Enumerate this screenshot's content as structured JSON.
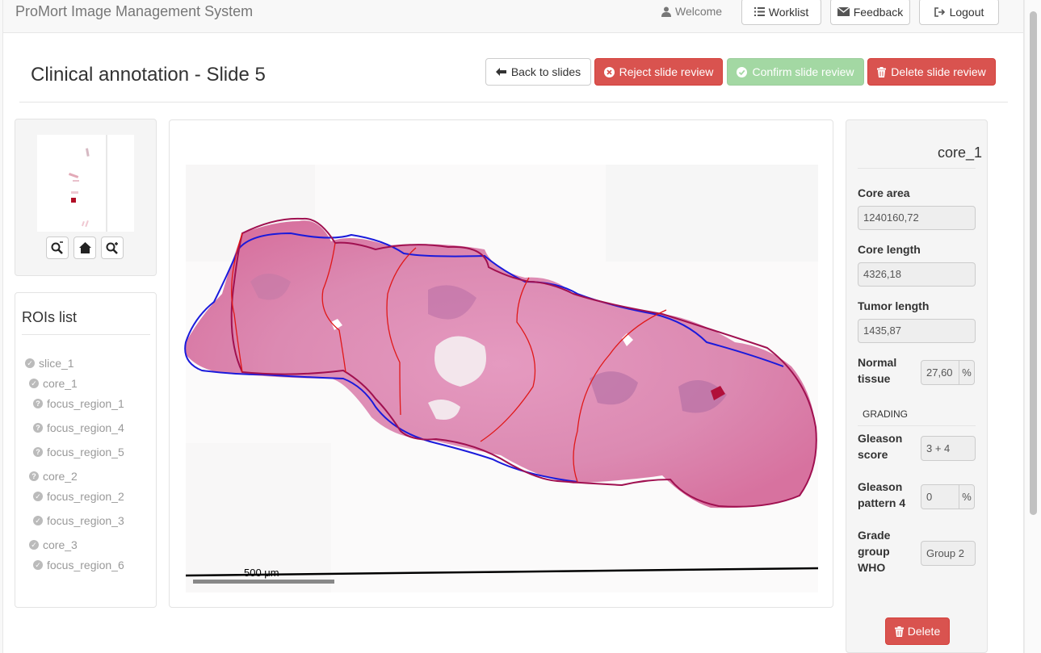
{
  "navbar": {
    "brand": "ProMort Image Management System",
    "welcome": "Welcome",
    "worklist": "Worklist",
    "feedback": "Feedback",
    "logout": "Logout"
  },
  "header": {
    "title": "Clinical annotation - Slide 5",
    "back_label": "Back to slides",
    "reject_label": "Reject slide review",
    "confirm_label": "Confirm slide review",
    "delete_label": "Delete slide review"
  },
  "rois": {
    "title": "ROIs list",
    "items": [
      {
        "label": "slice_1",
        "status": "done"
      },
      {
        "label": "core_1",
        "status": "done"
      },
      {
        "label": "focus_region_1",
        "status": "pending"
      },
      {
        "label": "focus_region_4",
        "status": "pending"
      },
      {
        "label": "focus_region_5",
        "status": "pending"
      },
      {
        "label": "core_2",
        "status": "pending"
      },
      {
        "label": "focus_region_2",
        "status": "done"
      },
      {
        "label": "focus_region_3",
        "status": "done"
      },
      {
        "label": "core_3",
        "status": "done"
      },
      {
        "label": "focus_region_6",
        "status": "done"
      }
    ]
  },
  "viewer": {
    "scale_label": "500 μm"
  },
  "details": {
    "title": "core_1",
    "core_area_label": "Core area",
    "core_area_value": "1240160,72",
    "core_length_label": "Core length",
    "core_length_value": "4326,18",
    "tumor_length_label": "Tumor length",
    "tumor_length_value": "1435,87",
    "normal_tissue_label_1": "Normal",
    "normal_tissue_label_2": "tissue",
    "normal_tissue_value": "27,60",
    "percent": "%",
    "grading_label": "GRADING",
    "gleason_score_label_1": "Gleason",
    "gleason_score_label_2": "score",
    "gleason_score_value": "3 + 4",
    "gleason_p4_label_1": "Gleason",
    "gleason_p4_label_2": "pattern 4",
    "gleason_p4_value": "0",
    "grade_group_label_1": "Grade",
    "grade_group_label_2": "group",
    "grade_group_label_3": "WHO",
    "grade_group_value": "Group 2",
    "delete_label": "Delete"
  },
  "colors": {
    "danger": "#d9534f",
    "success_disabled": "#a3d8a3",
    "slice_outline": "#1a1adb",
    "core_outline": "#a01050",
    "focus_outline": "#e01818"
  }
}
